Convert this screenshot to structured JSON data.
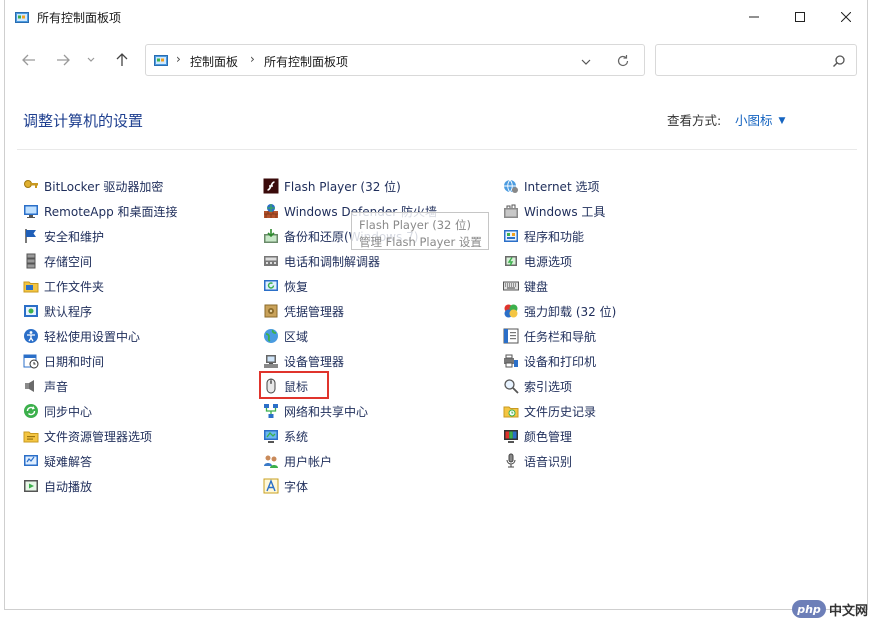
{
  "window": {
    "title": "所有控制面板项"
  },
  "address": {
    "crumbs": [
      "控制面板",
      "所有控制面板项"
    ]
  },
  "search": {
    "placeholder": ""
  },
  "heading": "调整计算机的设置",
  "view_by": {
    "label": "查看方式:",
    "value": "小图标"
  },
  "columns": [
    [
      "BitLocker 驱动器加密",
      "RemoteApp 和桌面连接",
      "安全和维护",
      "存储空间",
      "工作文件夹",
      "默认程序",
      "轻松使用设置中心",
      "日期和时间",
      "声音",
      "同步中心",
      "文件资源管理器选项",
      "疑难解答",
      "自动播放"
    ],
    [
      "Flash Player (32 位)",
      "Windows Defender 防火墙",
      "备份和还原(Windows 7)",
      "电话和调制解调器",
      "恢复",
      "凭据管理器",
      "区域",
      "设备管理器",
      "鼠标",
      "网络和共享中心",
      "系统",
      "用户帐户",
      "字体"
    ],
    [
      "Internet 选项",
      "Windows 工具",
      "程序和功能",
      "电源选项",
      "键盘",
      "强力卸载 (32 位)",
      "任务栏和导航",
      "设备和打印机",
      "索引选项",
      "文件历史记录",
      "颜色管理",
      "语音识别"
    ]
  ],
  "tooltip": {
    "line1": "Flash Player (32 位)",
    "line2": "管理 Flash Player 设置"
  },
  "watermark": {
    "logo": "php",
    "text": "中文网"
  },
  "colors": {
    "accent": "#1564c0",
    "heading": "#1e3f8f",
    "highlight": "#e0342c"
  }
}
